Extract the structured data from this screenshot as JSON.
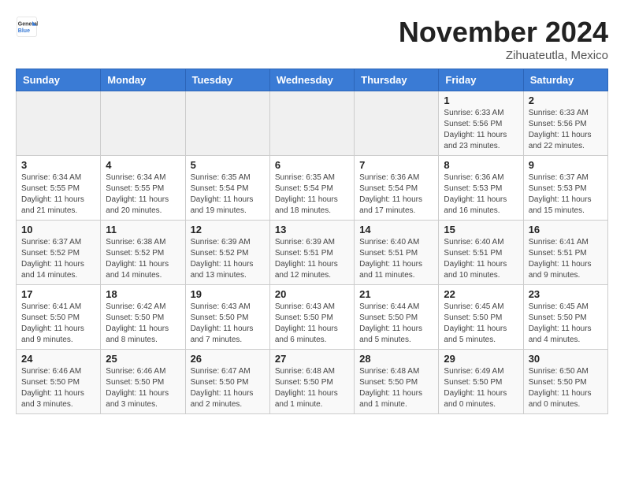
{
  "header": {
    "logo_general": "General",
    "logo_blue": "Blue",
    "month": "November 2024",
    "location": "Zihuateutla, Mexico"
  },
  "days_of_week": [
    "Sunday",
    "Monday",
    "Tuesday",
    "Wednesday",
    "Thursday",
    "Friday",
    "Saturday"
  ],
  "weeks": [
    [
      {
        "day": "",
        "info": ""
      },
      {
        "day": "",
        "info": ""
      },
      {
        "day": "",
        "info": ""
      },
      {
        "day": "",
        "info": ""
      },
      {
        "day": "",
        "info": ""
      },
      {
        "day": "1",
        "info": "Sunrise: 6:33 AM\nSunset: 5:56 PM\nDaylight: 11 hours and 23 minutes."
      },
      {
        "day": "2",
        "info": "Sunrise: 6:33 AM\nSunset: 5:56 PM\nDaylight: 11 hours and 22 minutes."
      }
    ],
    [
      {
        "day": "3",
        "info": "Sunrise: 6:34 AM\nSunset: 5:55 PM\nDaylight: 11 hours and 21 minutes."
      },
      {
        "day": "4",
        "info": "Sunrise: 6:34 AM\nSunset: 5:55 PM\nDaylight: 11 hours and 20 minutes."
      },
      {
        "day": "5",
        "info": "Sunrise: 6:35 AM\nSunset: 5:54 PM\nDaylight: 11 hours and 19 minutes."
      },
      {
        "day": "6",
        "info": "Sunrise: 6:35 AM\nSunset: 5:54 PM\nDaylight: 11 hours and 18 minutes."
      },
      {
        "day": "7",
        "info": "Sunrise: 6:36 AM\nSunset: 5:54 PM\nDaylight: 11 hours and 17 minutes."
      },
      {
        "day": "8",
        "info": "Sunrise: 6:36 AM\nSunset: 5:53 PM\nDaylight: 11 hours and 16 minutes."
      },
      {
        "day": "9",
        "info": "Sunrise: 6:37 AM\nSunset: 5:53 PM\nDaylight: 11 hours and 15 minutes."
      }
    ],
    [
      {
        "day": "10",
        "info": "Sunrise: 6:37 AM\nSunset: 5:52 PM\nDaylight: 11 hours and 14 minutes."
      },
      {
        "day": "11",
        "info": "Sunrise: 6:38 AM\nSunset: 5:52 PM\nDaylight: 11 hours and 14 minutes."
      },
      {
        "day": "12",
        "info": "Sunrise: 6:39 AM\nSunset: 5:52 PM\nDaylight: 11 hours and 13 minutes."
      },
      {
        "day": "13",
        "info": "Sunrise: 6:39 AM\nSunset: 5:51 PM\nDaylight: 11 hours and 12 minutes."
      },
      {
        "day": "14",
        "info": "Sunrise: 6:40 AM\nSunset: 5:51 PM\nDaylight: 11 hours and 11 minutes."
      },
      {
        "day": "15",
        "info": "Sunrise: 6:40 AM\nSunset: 5:51 PM\nDaylight: 11 hours and 10 minutes."
      },
      {
        "day": "16",
        "info": "Sunrise: 6:41 AM\nSunset: 5:51 PM\nDaylight: 11 hours and 9 minutes."
      }
    ],
    [
      {
        "day": "17",
        "info": "Sunrise: 6:41 AM\nSunset: 5:50 PM\nDaylight: 11 hours and 9 minutes."
      },
      {
        "day": "18",
        "info": "Sunrise: 6:42 AM\nSunset: 5:50 PM\nDaylight: 11 hours and 8 minutes."
      },
      {
        "day": "19",
        "info": "Sunrise: 6:43 AM\nSunset: 5:50 PM\nDaylight: 11 hours and 7 minutes."
      },
      {
        "day": "20",
        "info": "Sunrise: 6:43 AM\nSunset: 5:50 PM\nDaylight: 11 hours and 6 minutes."
      },
      {
        "day": "21",
        "info": "Sunrise: 6:44 AM\nSunset: 5:50 PM\nDaylight: 11 hours and 5 minutes."
      },
      {
        "day": "22",
        "info": "Sunrise: 6:45 AM\nSunset: 5:50 PM\nDaylight: 11 hours and 5 minutes."
      },
      {
        "day": "23",
        "info": "Sunrise: 6:45 AM\nSunset: 5:50 PM\nDaylight: 11 hours and 4 minutes."
      }
    ],
    [
      {
        "day": "24",
        "info": "Sunrise: 6:46 AM\nSunset: 5:50 PM\nDaylight: 11 hours and 3 minutes."
      },
      {
        "day": "25",
        "info": "Sunrise: 6:46 AM\nSunset: 5:50 PM\nDaylight: 11 hours and 3 minutes."
      },
      {
        "day": "26",
        "info": "Sunrise: 6:47 AM\nSunset: 5:50 PM\nDaylight: 11 hours and 2 minutes."
      },
      {
        "day": "27",
        "info": "Sunrise: 6:48 AM\nSunset: 5:50 PM\nDaylight: 11 hours and 1 minute."
      },
      {
        "day": "28",
        "info": "Sunrise: 6:48 AM\nSunset: 5:50 PM\nDaylight: 11 hours and 1 minute."
      },
      {
        "day": "29",
        "info": "Sunrise: 6:49 AM\nSunset: 5:50 PM\nDaylight: 11 hours and 0 minutes."
      },
      {
        "day": "30",
        "info": "Sunrise: 6:50 AM\nSunset: 5:50 PM\nDaylight: 11 hours and 0 minutes."
      }
    ]
  ]
}
